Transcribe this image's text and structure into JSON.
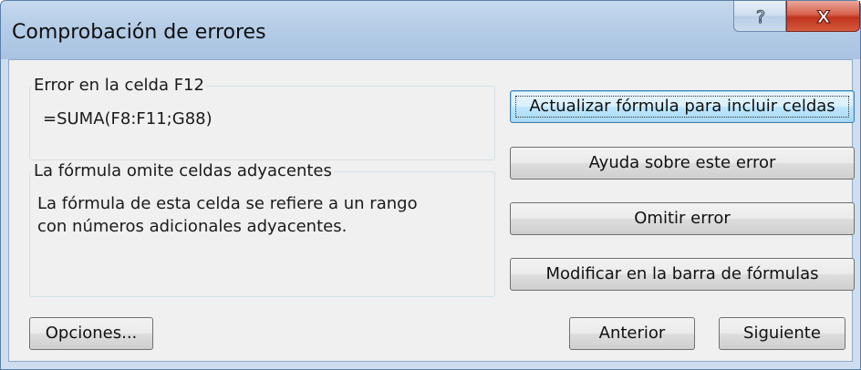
{
  "window": {
    "title": "Comprobación de errores",
    "help_glyph": "?",
    "close_glyph": "X"
  },
  "error_cell": {
    "legend": "Error en la celda F12",
    "formula": "=SUMA(F8:F11;G88)"
  },
  "error_description": {
    "legend": "La fórmula omite celdas adyacentes",
    "text_line1": "La fórmula de esta celda se refiere a un rango",
    "text_line2": "con números adicionales adyacentes."
  },
  "actions": {
    "update_formula": "Actualizar fórmula para incluir celdas",
    "help_on_error": "Ayuda sobre este error",
    "ignore_error": "Omitir error",
    "edit_in_formula_bar": "Modificar en la barra de fórmulas"
  },
  "footer": {
    "options": "Opciones...",
    "previous": "Anterior",
    "next": "Siguiente"
  },
  "colors": {
    "title_bar": "#b3cbe6",
    "client_background": "#f0f0f0",
    "close_button": "#c2331d",
    "default_button_border": "#3c7fb1"
  }
}
